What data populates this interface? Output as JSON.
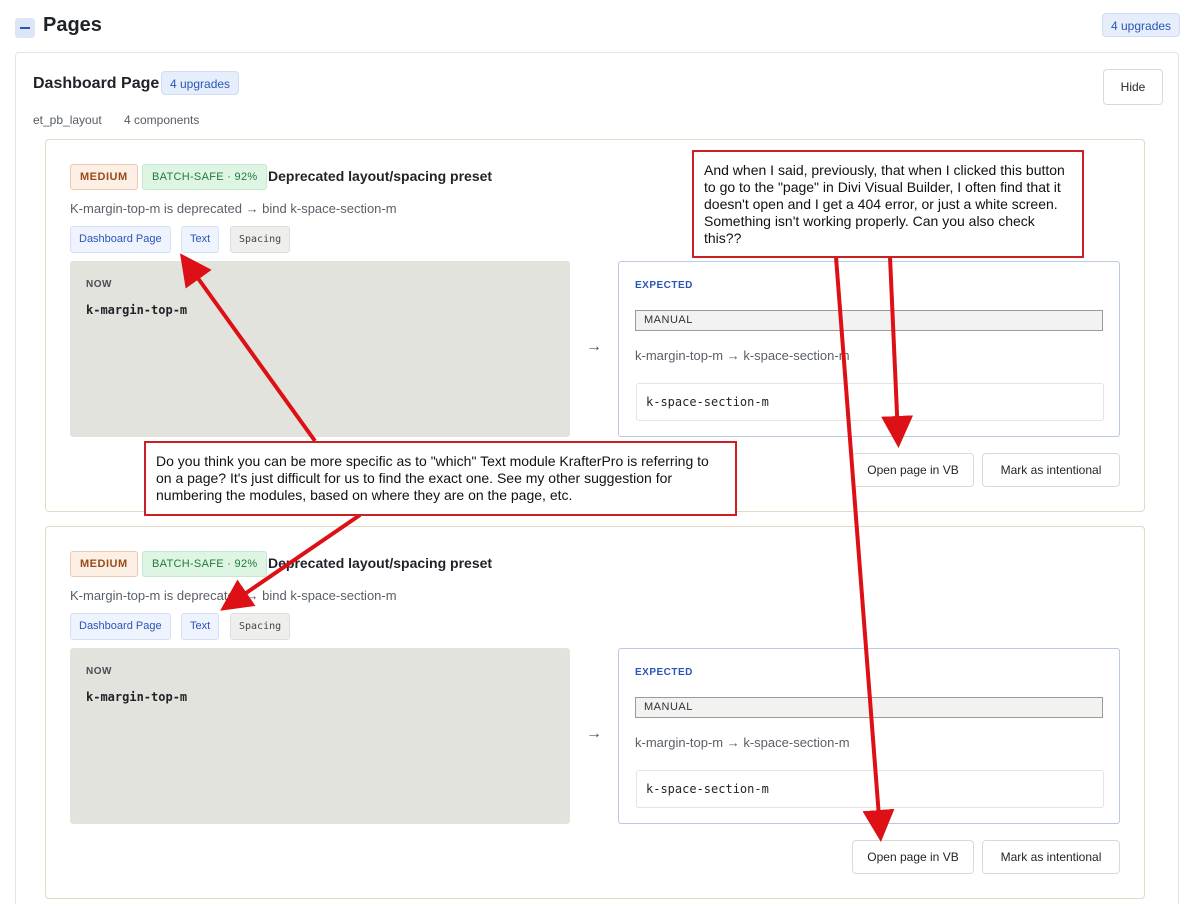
{
  "header": {
    "title": "Pages",
    "upgrades_badge": "4 upgrades"
  },
  "section": {
    "title": "Dashboard Page",
    "upgrades_badge": "4 upgrades",
    "hide_label": "Hide",
    "meta_layout": "et_pb_layout",
    "meta_components": "4 components"
  },
  "issues": [
    {
      "severity": "MEDIUM",
      "batch": "BATCH-SAFE · 92%",
      "title": "Deprecated layout/spacing preset",
      "description": "K-margin-top-m is deprecated → bind k-space-section-m",
      "tags": [
        "Dashboard Page",
        "Text",
        "Spacing"
      ],
      "now_label": "NOW",
      "now_value": "k-margin-top-m",
      "arrow": "→",
      "expected_label": "EXPECTED",
      "manual_label": "MANUAL",
      "expected_desc": "k-margin-top-m → k-space-section-m",
      "expected_value": "k-space-section-m",
      "open_vb_label": "Open page in VB",
      "mark_intentional_label": "Mark as intentional"
    },
    {
      "severity": "MEDIUM",
      "batch": "BATCH-SAFE · 92%",
      "title": "Deprecated layout/spacing preset",
      "description": "K-margin-top-m is deprecated → bind k-space-section-m",
      "tags": [
        "Dashboard Page",
        "Text",
        "Spacing"
      ],
      "now_label": "NOW",
      "now_value": "k-margin-top-m",
      "arrow": "→",
      "expected_label": "EXPECTED",
      "manual_label": "MANUAL",
      "expected_desc": "k-margin-top-m → k-space-section-m",
      "expected_value": "k-space-section-m",
      "open_vb_label": "Open page in VB",
      "mark_intentional_label": "Mark as intentional"
    }
  ],
  "annotations": {
    "vb_note": "And when I said, previously, that when I clicked this button to go to the \"page\" in Divi Visual Builder, I often find that it doesn't open and I get a 404 error, or just a white screen. Something isn't working properly. Can you also check this??",
    "text_note": "Do you think you can be more specific as to \"which\" Text module KrafterPro is referring to on a page? It's just difficult for us to find the exact one. See my other suggestion for numbering the modules, based on where they are on the page, etc."
  },
  "colors": {
    "annotation_red": "#cc1f24",
    "accent_blue": "#2c55b8"
  }
}
